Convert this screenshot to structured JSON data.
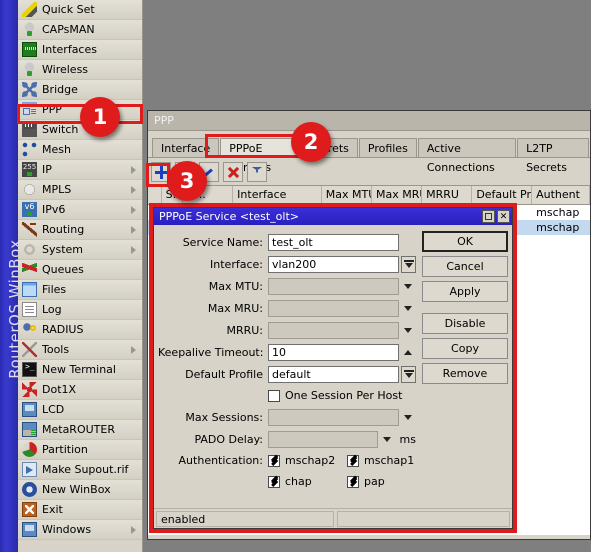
{
  "app": {
    "brand": "RouterOS WinBox",
    "desktop_color": "#7f7f7f"
  },
  "sidebar": {
    "items": [
      {
        "label": "Quick Set",
        "icon": "wand-icon",
        "submenu": false
      },
      {
        "label": "CAPsMAN",
        "icon": "access-point-icon",
        "submenu": false
      },
      {
        "label": "Interfaces",
        "icon": "interface-card-icon",
        "submenu": false
      },
      {
        "label": "Wireless",
        "icon": "antenna-icon",
        "submenu": false
      },
      {
        "label": "Bridge",
        "icon": "bridge-icon",
        "submenu": false
      },
      {
        "label": "PPP",
        "icon": "ppp-icon",
        "submenu": false,
        "highlighted": true
      },
      {
        "label": "Switch",
        "icon": "switch-icon",
        "submenu": false
      },
      {
        "label": "Mesh",
        "icon": "mesh-icon",
        "submenu": false
      },
      {
        "label": "IP",
        "icon": "ip-icon",
        "submenu": true
      },
      {
        "label": "MPLS",
        "icon": "mpls-icon",
        "submenu": true
      },
      {
        "label": "IPv6",
        "icon": "ipv6-icon",
        "submenu": true
      },
      {
        "label": "Routing",
        "icon": "routing-icon",
        "submenu": true
      },
      {
        "label": "System",
        "icon": "gear-icon",
        "submenu": true
      },
      {
        "label": "Queues",
        "icon": "queues-icon",
        "submenu": false
      },
      {
        "label": "Files",
        "icon": "folder-icon",
        "submenu": false
      },
      {
        "label": "Log",
        "icon": "log-icon",
        "submenu": false
      },
      {
        "label": "RADIUS",
        "icon": "radius-key-icon",
        "submenu": false
      },
      {
        "label": "Tools",
        "icon": "tools-icon",
        "submenu": true
      },
      {
        "label": "New Terminal",
        "icon": "terminal-icon",
        "submenu": false
      },
      {
        "label": "Dot1X",
        "icon": "dot1x-icon",
        "submenu": false
      },
      {
        "label": "LCD",
        "icon": "lcd-icon",
        "submenu": false
      },
      {
        "label": "MetaROUTER",
        "icon": "metarouter-icon",
        "submenu": false
      },
      {
        "label": "Partition",
        "icon": "partition-icon",
        "submenu": false
      },
      {
        "label": "Make Supout.rif",
        "icon": "supout-icon",
        "submenu": false
      },
      {
        "label": "New WinBox",
        "icon": "winbox-icon",
        "submenu": false
      },
      {
        "label": "Exit",
        "icon": "exit-icon",
        "submenu": false
      },
      {
        "label": "Windows",
        "icon": "windows-icon",
        "submenu": true
      }
    ]
  },
  "ppp_window": {
    "title": "PPP",
    "tabs": [
      {
        "label": "Interface",
        "active": false
      },
      {
        "label": "PPPoE Servers",
        "active": true
      },
      {
        "label": "Secrets",
        "active": false
      },
      {
        "label": "Profiles",
        "active": false
      },
      {
        "label": "Active Connections",
        "active": false
      },
      {
        "label": "L2TP Secrets",
        "active": false
      }
    ],
    "toolbar": [
      {
        "name": "add-button",
        "icon": "plus-icon"
      },
      {
        "name": "remove-button",
        "icon": "minus-icon"
      },
      {
        "name": "enable-button",
        "icon": "check-icon"
      },
      {
        "name": "disable-button",
        "icon": "x-icon"
      },
      {
        "name": "filter-button",
        "icon": "filter-icon"
      }
    ],
    "table": {
      "columns": [
        "",
        "S...",
        "N...",
        "Interface",
        "Max MTU",
        "Max MRU",
        "MRRU",
        "Default Pro...",
        "Authent"
      ],
      "rows": [
        {
          "auth": "mschap",
          "selected": false
        },
        {
          "auth": "mschap",
          "selected": true
        }
      ]
    }
  },
  "dialog": {
    "title": "PPPoE Service <test_olt>",
    "sys_buttons": {
      "maximize": "maximize-icon",
      "close": "✕"
    },
    "fields": [
      {
        "label": "Service Name:",
        "value": "test_olt",
        "control": "text",
        "disabled": false
      },
      {
        "label": "Interface:",
        "value": "vlan200",
        "control": "combo",
        "disabled": false
      },
      {
        "label": "Max MTU:",
        "value": "",
        "control": "dropdown",
        "disabled": true
      },
      {
        "label": "Max MRU:",
        "value": "",
        "control": "dropdown",
        "disabled": true
      },
      {
        "label": "MRRU:",
        "value": "",
        "control": "dropdown",
        "disabled": true
      },
      {
        "label": "Keepalive Timeout:",
        "value": "10",
        "control": "spinner",
        "disabled": false
      },
      {
        "label": "Default Profile",
        "value": "default",
        "control": "combo",
        "disabled": false
      }
    ],
    "one_session": {
      "label": "One Session Per Host",
      "checked": false
    },
    "fields2": [
      {
        "label": "Max Sessions:",
        "value": "",
        "control": "dropdown",
        "disabled": true,
        "unit": ""
      },
      {
        "label": "PADO Delay:",
        "value": "",
        "control": "dropdown",
        "disabled": true,
        "unit": "ms"
      }
    ],
    "auth": {
      "label": "Authentication:",
      "options": [
        {
          "label": "mschap2",
          "checked": true
        },
        {
          "label": "mschap1",
          "checked": true
        },
        {
          "label": "chap",
          "checked": true
        },
        {
          "label": "pap",
          "checked": true
        }
      ]
    },
    "buttons": [
      {
        "label": "OK",
        "primary": true,
        "gap": false
      },
      {
        "label": "Cancel",
        "primary": false,
        "gap": false
      },
      {
        "label": "Apply",
        "primary": false,
        "gap": false
      },
      {
        "label": "Disable",
        "primary": false,
        "gap": true
      },
      {
        "label": "Copy",
        "primary": false,
        "gap": false
      },
      {
        "label": "Remove",
        "primary": false,
        "gap": false
      }
    ],
    "status": "enabled"
  },
  "annotations": {
    "accent_color": "#e01b1b",
    "badges": [
      {
        "number": "1",
        "target": "sidebar-item-ppp"
      },
      {
        "number": "2",
        "target": "tab-pppoe-servers"
      },
      {
        "number": "3",
        "target": "add-button"
      }
    ]
  }
}
